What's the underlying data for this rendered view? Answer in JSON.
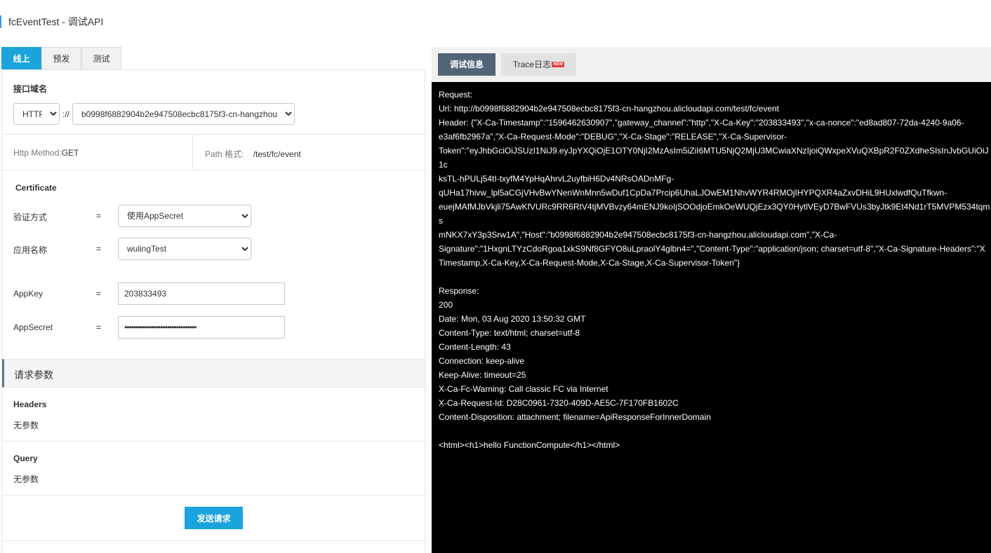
{
  "page": {
    "title": "fcEventTest - 调试API"
  },
  "env_tabs": [
    {
      "label": "线上",
      "active": true
    },
    {
      "label": "预发",
      "active": false
    },
    {
      "label": "测试",
      "active": false
    }
  ],
  "domain": {
    "label": "接口域名",
    "protocol": "HTTP",
    "separator": "://",
    "host": "b0998f6882904b2e947508ecbc8175f3-cn-hangzhou"
  },
  "method": {
    "label": "Http Method:",
    "value": "GET"
  },
  "path": {
    "label": "Path 格式:",
    "value": "/test/fc/event"
  },
  "certificate": {
    "title": "Certificate",
    "eq": "=",
    "auth_label": "验证方式",
    "auth_value": "使用AppSecret",
    "app_label": "应用名称",
    "app_value": "wulingTest",
    "appkey_label": "AppKey",
    "appkey_value": "203833493",
    "appsecret_label": "AppSecret",
    "appsecret_value": "••••••••••••••••••••••••••••••••"
  },
  "params": {
    "title": "请求参数",
    "headers_label": "Headers",
    "headers_empty": "无参数",
    "query_label": "Query",
    "query_empty": "无参数"
  },
  "send_button": "发送请求",
  "right_tabs": {
    "debug": "调试信息",
    "trace": "Trace日志",
    "badge": "NEW"
  },
  "console_text": "Request:\nUrl: http://b0998f6882904b2e947508ecbc8175f3-cn-hangzhou.alicloudapi.com/test/fc/event\nHeader: {\"X-Ca-Timestamp\":\"1596462630907\",\"gateway_channel\":\"http\",\"X-Ca-Key\":\"203833493\",\"x-ca-nonce\":\"ed8ad807-72da-4240-9a06-\ne3af6fb2967a\",\"X-Ca-Request-Mode\":\"DEBUG\",\"X-Ca-Stage\":\"RELEASE\",\"X-Ca-Supervisor-\nToken\":\"eyJhbGciOiJSUzI1NiJ9.eyJpYXQiOjE1OTY0NjI2MzAsIm5iZiI6MTU5NjQ2MjU3MCwiaXNzIjoiQWxpeXVuQXBpR2F0ZXdheSIsInJvbGUiOiJ1c\nksTL-hPULj54tI-txyfM4YpHqAhrvL2uyfbiH6Dv4NRsOADnMFg-\nqUHa17hivw_lpl5aCGjVHvBwYNenWnMnn5wDuf1CpDa7Prcip6UhaLJOwEM1NhvWYR4RMOjIHYPQXR4aZxvDHiL9HUxlwdfQuTfkwn-\neuejMAfMJbVkjli75AwKfVURc9RR6RtV4tjMVBvzy64mENJ9koIjSOOdjoEmkOeWUQjEzx3QY0HytlVEyD7BwFVUs3byJtk9Et4Nd1rT5MVPM534tqms\nmNKX7xY3p3Srw1A\",\"Host\":\"b0998f6882904b2e947508ecbc8175f3-cn-hangzhou.alicloudapi.com\",\"X-Ca-\nSignature\":\"1HxgnLTYzCdoRgoa1xkS9Nf8GFYO8uLpraolY4glbn4=\",\"Content-Type\":\"application/json; charset=utf-8\",\"X-Ca-Signature-Headers\":\"X\nTimestamp,X-Ca-Key,X-Ca-Request-Mode,X-Ca-Stage,X-Ca-Supervisor-Token\"}\n\nResponse:\n200\nDate: Mon, 03 Aug 2020 13:50:32 GMT\nContent-Type: text/html; charset=utf-8\nContent-Length: 43\nConnection: keep-alive\nKeep-Alive: timeout=25\nX-Ca-Fc-Warning: Call classic FC via Internet\nX-Ca-Request-Id: D28C0961-7320-409D-AE5C-7F170FB1602C\nContent-Disposition: attachment; filename=ApiResponseForInnerDomain\n\n<html><h1>hello FunctionCompute</h1></html>"
}
